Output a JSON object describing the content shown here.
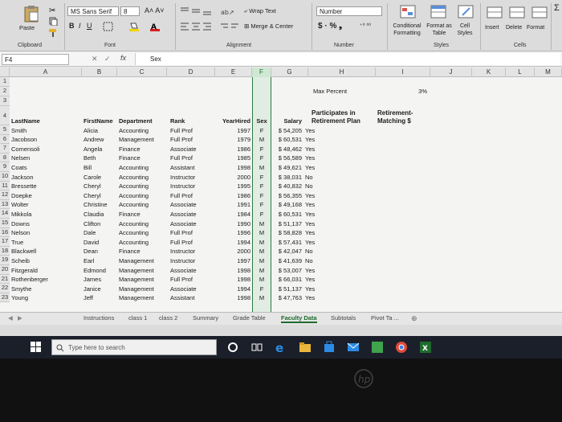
{
  "ribbon": {
    "font_name": "MS Sans Serif",
    "font_size": "8",
    "wrap_text": "Wrap Text",
    "merge_center": "Merge & Center",
    "number_format": "Number",
    "paste": "Paste",
    "conditional_formatting": "Conditional Formatting",
    "format_as_table": "Format as Table",
    "cell_styles": "Cell Styles",
    "insert": "Insert",
    "delete": "Delete",
    "format": "Format",
    "groups": [
      "Clipboard",
      "Font",
      "Alignment",
      "Number",
      "Styles",
      "Cells"
    ]
  },
  "formula_bar": {
    "name_box": "F4",
    "fx": "fx",
    "value": "Sex"
  },
  "columns": [
    "A",
    "B",
    "C",
    "D",
    "E",
    "F",
    "G",
    "H",
    "I",
    "J",
    "K",
    "L",
    "M"
  ],
  "selected_column": "F",
  "sheet": {
    "max_percent_label": "Max Percent",
    "max_percent_value": "3%",
    "headers": {
      "last": "LastName",
      "first": "FirstName",
      "dept": "Department",
      "rank": "Rank",
      "year": "YearHired",
      "sex": "Sex",
      "salary": "Salary",
      "retire1": "Participates in",
      "retire2": "Retirement Plan",
      "match1": "Retirement-",
      "match2": "Matching $"
    },
    "rows": [
      {
        "n": "5",
        "last": "Smith",
        "first": "Alicia",
        "dept": "Accounting",
        "rank": "Full Prof",
        "year": "1997",
        "sex": "F",
        "salary": "$ 54,205",
        "plan": "Yes"
      },
      {
        "n": "6",
        "last": "Jacobson",
        "first": "Andrew",
        "dept": "Management",
        "rank": "Full Prof",
        "year": "1979",
        "sex": "M",
        "salary": "$ 60,531",
        "plan": "Yes"
      },
      {
        "n": "7",
        "last": "Comensoli",
        "first": "Angela",
        "dept": "Finance",
        "rank": "Associate",
        "year": "1986",
        "sex": "F",
        "salary": "$ 48,462",
        "plan": "Yes"
      },
      {
        "n": "8",
        "last": "Nelsen",
        "first": "Beth",
        "dept": "Finance",
        "rank": "Full Prof",
        "year": "1985",
        "sex": "F",
        "salary": "$ 56,589",
        "plan": "Yes"
      },
      {
        "n": "9",
        "last": "Coats",
        "first": "Bill",
        "dept": "Accounting",
        "rank": "Assistant",
        "year": "1998",
        "sex": "M",
        "salary": "$ 49,621",
        "plan": "Yes"
      },
      {
        "n": "10",
        "last": "Jackson",
        "first": "Carole",
        "dept": "Accounting",
        "rank": "Instructor",
        "year": "2000",
        "sex": "F",
        "salary": "$ 38,031",
        "plan": "No"
      },
      {
        "n": "11",
        "last": "Bressette",
        "first": "Cheryl",
        "dept": "Accounting",
        "rank": "Instructor",
        "year": "1995",
        "sex": "F",
        "salary": "$ 40,832",
        "plan": "No"
      },
      {
        "n": "12",
        "last": "Doepke",
        "first": "Cheryl",
        "dept": "Accounting",
        "rank": "Full Prof",
        "year": "1986",
        "sex": "F",
        "salary": "$ 56,355",
        "plan": "Yes"
      },
      {
        "n": "13",
        "last": "Wolter",
        "first": "Christine",
        "dept": "Accounting",
        "rank": "Associate",
        "year": "1991",
        "sex": "F",
        "salary": "$ 49,168",
        "plan": "Yes"
      },
      {
        "n": "14",
        "last": "Mikkola",
        "first": "Claudia",
        "dept": "Finance",
        "rank": "Associate",
        "year": "1984",
        "sex": "F",
        "salary": "$ 60,531",
        "plan": "Yes"
      },
      {
        "n": "15",
        "last": "Downs",
        "first": "Clifton",
        "dept": "Accounting",
        "rank": "Associate",
        "year": "1990",
        "sex": "M",
        "salary": "$ 51,137",
        "plan": "Yes"
      },
      {
        "n": "16",
        "last": "Nelson",
        "first": "Dale",
        "dept": "Accounting",
        "rank": "Full Prof",
        "year": "1996",
        "sex": "M",
        "salary": "$ 58,828",
        "plan": "Yes"
      },
      {
        "n": "17",
        "last": "True",
        "first": "David",
        "dept": "Accounting",
        "rank": "Full Prof",
        "year": "1994",
        "sex": "M",
        "salary": "$ 57,431",
        "plan": "Yes"
      },
      {
        "n": "18",
        "last": "Blackwell",
        "first": "Dean",
        "dept": "Finance",
        "rank": "Instructor",
        "year": "2000",
        "sex": "M",
        "salary": "$ 42,047",
        "plan": "No"
      },
      {
        "n": "19",
        "last": "Scheib",
        "first": "Earl",
        "dept": "Management",
        "rank": "Instructor",
        "year": "1997",
        "sex": "M",
        "salary": "$ 41,639",
        "plan": "No"
      },
      {
        "n": "20",
        "last": "Fitzgerald",
        "first": "Edmond",
        "dept": "Management",
        "rank": "Associate",
        "year": "1998",
        "sex": "M",
        "salary": "$ 53,007",
        "plan": "Yes"
      },
      {
        "n": "21",
        "last": "Rothenberger",
        "first": "James",
        "dept": "Management",
        "rank": "Full Prof",
        "year": "1998",
        "sex": "M",
        "salary": "$ 66,031",
        "plan": "Yes"
      },
      {
        "n": "22",
        "last": "Smythe",
        "first": "Janice",
        "dept": "Management",
        "rank": "Associate",
        "year": "1994",
        "sex": "F",
        "salary": "$ 51,137",
        "plan": "Yes"
      },
      {
        "n": "23",
        "last": "Young",
        "first": "Jeff",
        "dept": "Management",
        "rank": "Assistant",
        "year": "1998",
        "sex": "M",
        "salary": "$ 47,763",
        "plan": "Yes"
      }
    ]
  },
  "tabs": [
    "Instructions",
    "class 1",
    "class 2",
    "Summary",
    "Grade Table",
    "Faculty Data",
    "Subtotals",
    "Pivot Ta ..."
  ],
  "active_tab": "Faculty Data",
  "taskbar": {
    "search_placeholder": "Type here to search"
  },
  "colors": {
    "excel_green": "#1e6b2d",
    "taskbar": "#1b1f2a"
  }
}
